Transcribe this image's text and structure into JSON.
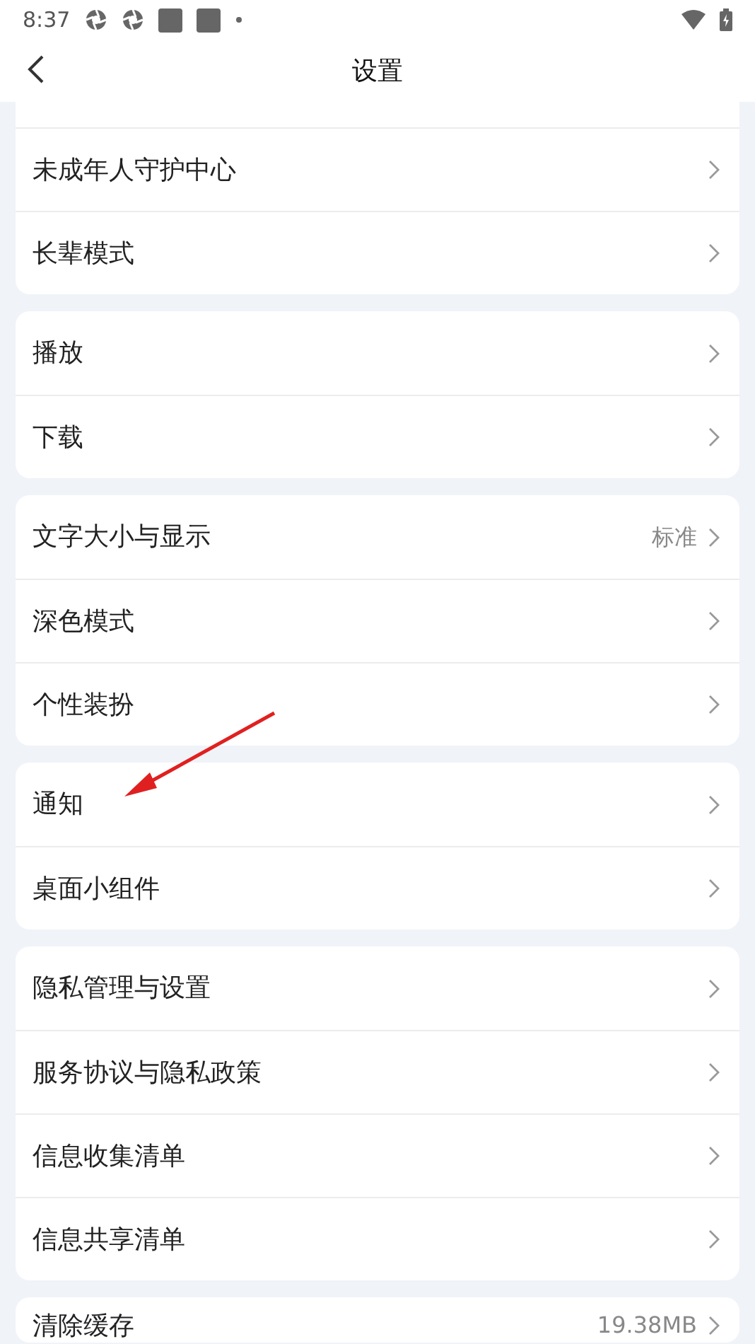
{
  "status_bar": {
    "time": "8:37"
  },
  "header": {
    "title": "设置"
  },
  "groups": [
    {
      "cut_top": true,
      "items": [
        {
          "label": "未成年人守护中心"
        },
        {
          "label": "长辈模式"
        }
      ]
    },
    {
      "cut_top": false,
      "items": [
        {
          "label": "播放"
        },
        {
          "label": "下载"
        }
      ]
    },
    {
      "cut_top": false,
      "items": [
        {
          "label": "文字大小与显示",
          "value": "标准"
        },
        {
          "label": "深色模式"
        },
        {
          "label": "个性装扮"
        }
      ]
    },
    {
      "cut_top": false,
      "items": [
        {
          "label": "通知"
        },
        {
          "label": "桌面小组件"
        }
      ]
    },
    {
      "cut_top": false,
      "items": [
        {
          "label": "隐私管理与设置"
        },
        {
          "label": "服务协议与隐私政策"
        },
        {
          "label": "信息收集清单"
        },
        {
          "label": "信息共享清单"
        }
      ]
    },
    {
      "cut_top": false,
      "items": [
        {
          "label": "清除缓存",
          "value": "19.38MB"
        }
      ]
    }
  ],
  "annotations": [
    {
      "kind": "arrow"
    }
  ]
}
